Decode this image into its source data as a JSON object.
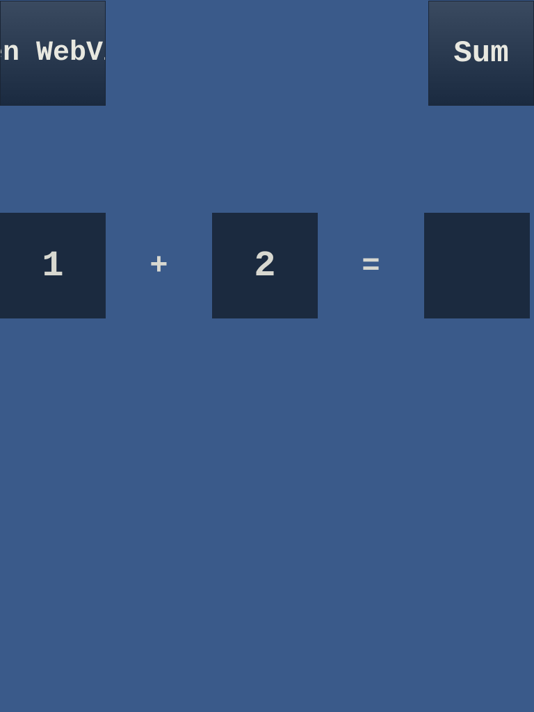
{
  "buttons": {
    "open_webview": "Open WebView",
    "sum": "Sum"
  },
  "calc": {
    "operand1": "1",
    "plus": "+",
    "operand2": "2",
    "equals": "=",
    "result": ""
  }
}
